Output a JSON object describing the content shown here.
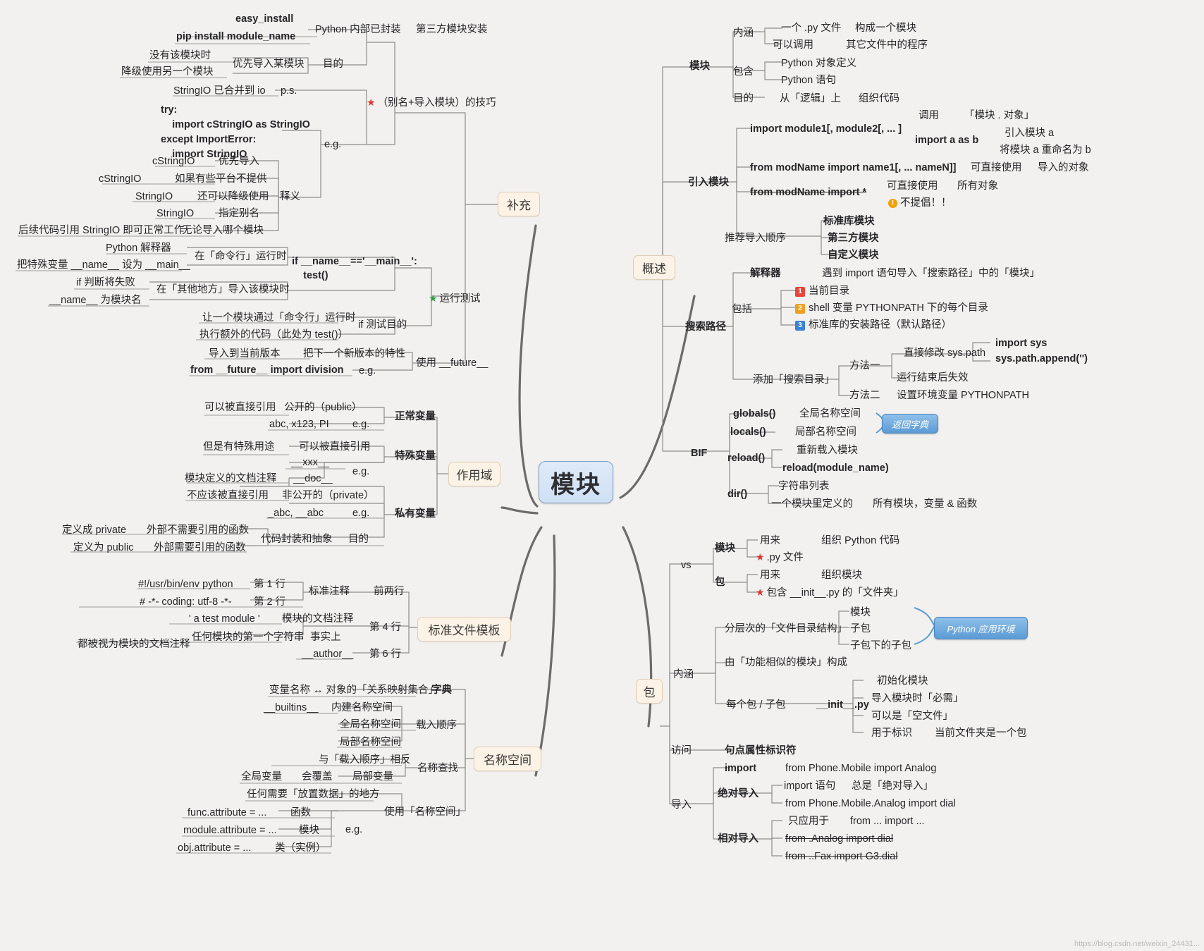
{
  "title": "模块",
  "root": {
    "label": "模块"
  },
  "level1": [
    {
      "label": "补充"
    },
    {
      "label": "概述"
    },
    {
      "label": "作用域"
    },
    {
      "label": "标准文件模板"
    },
    {
      "label": "名称空间"
    },
    {
      "label": "包"
    }
  ],
  "bubbles": [
    {
      "label": "返回字典"
    },
    {
      "label": "Python 应用环境"
    }
  ],
  "supplement": {
    "install": {
      "easy_install": "easy_install",
      "pip": "pip install module_name",
      "python_builtin": "Python 内部已封装",
      "third_party": "第三方模块安装"
    },
    "alias_trick": {
      "label": "（别名+导入模块）的技巧",
      "purpose_label": "目的",
      "purpose_a": "优先导入某模块",
      "purpose_b": "没有该模块时",
      "purpose_c": "降级使用另一个模块",
      "ps_label": "p.s.",
      "ps_text": "StringIO 已合并到 io",
      "eg_label": "e.g.",
      "code": "try:\n    import cStringIO as StringIO\nexcept ImportError:\n    import StringIO",
      "explain_label": "释义",
      "rows": [
        {
          "left": "cStringIO",
          "right": "优先导入"
        },
        {
          "left": "cStringIO",
          "right": "如果有些平台不提供"
        },
        {
          "left": "StringIO",
          "right": "还可以降级使用"
        },
        {
          "left": "StringIO",
          "right": "指定别名"
        },
        {
          "left": "后续代码引用 StringIO 即可正常工作",
          "right": "无论导入哪个模块"
        }
      ]
    },
    "run_test": {
      "label": "运行测试",
      "code": "if __name__=='__main__':\n    test()",
      "cmdline": "在「命令行」运行时",
      "cmdline_a": "Python 解释器",
      "cmdline_b": "把特殊变量 __name__ 设为 __main__",
      "elsewhere": "在「其他地方」导入该模块时",
      "elsewhere_a": "if 判断将失败",
      "elsewhere_b": "__name__ 为模块名",
      "purpose_label": "if 测试目的",
      "purpose_a": "让一个模块通过「命令行」运行时",
      "purpose_b": "执行额外的代码（此处为 test()）"
    },
    "future": {
      "label": "使用 __future__",
      "a": "把下一个新版本的特性",
      "b": "导入到当前版本",
      "eg_label": "e.g.",
      "code": "from __future__ import division"
    }
  },
  "overview": {
    "module": {
      "label": "模块",
      "connotation_label": "内涵",
      "connotation": [
        {
          "left": "一个 .py 文件",
          "right": "构成一个模块"
        },
        {
          "left": "可以调用",
          "right": "其它文件中的程序"
        }
      ],
      "contains_label": "包含",
      "contains": [
        "Python 对象定义",
        "Python 语句"
      ],
      "purpose_label": "目的",
      "purpose_a": "从「逻辑」上",
      "purpose_b": "组织代码"
    },
    "import": {
      "label": "引入模块",
      "stmt1": "import module1[, module2[, ... ]",
      "stmt1_a": "调用",
      "stmt1_b": "「模块 . 对象」",
      "stmt_as": "import a as b",
      "stmt_as_a": "引入模块 a",
      "stmt_as_b": "将模块 a 重命名为 b",
      "stmt2": "from modName import name1[, ... nameN]]",
      "stmt2_a": "可直接使用",
      "stmt2_b": "导入的对象",
      "stmt3": "from modName import *",
      "stmt3_a": "可直接使用",
      "stmt3_b": "所有对象",
      "stmt3_warn": "不提倡！！",
      "order_label": "推荐导入顺序",
      "order": [
        "标准库模块",
        "第三方模块",
        "自定义模块"
      ]
    },
    "search_path": {
      "label": "搜索路径",
      "interpreter": "解释器",
      "interpreter_a": "遇到 import 语句",
      "interpreter_b": "导入「搜索路径」中的「模块」",
      "includes_label": "包括",
      "includes": [
        {
          "n": "1",
          "text": "当前目录"
        },
        {
          "n": "2",
          "text": "shell 变量 PYTHONPATH 下的每个目录"
        },
        {
          "n": "3",
          "text": "标准库的安装路径（默认路径）"
        }
      ],
      "add_label": "添加「搜索目录」",
      "m1_label": "方法一",
      "m1_a": "直接修改 sys.path",
      "m1_code": "import sys\nsys.path.append('')",
      "m1_b": "运行结束后失效",
      "m2_label": "方法二",
      "m2_a": "设置环境变量 PYTHONPATH"
    },
    "bif": {
      "label": "BIF",
      "globals": "globals()",
      "globals_desc": "全局名称空间",
      "locals": "locals()",
      "locals_desc": "局部名称空间",
      "reload": "reload()",
      "reload_desc": "重新载入模块",
      "reload_code": "reload(module_name)",
      "dir": "dir()",
      "dir_desc": "字符串列表",
      "dir_a": "一个模块里定义的",
      "dir_b": "所有模块，变量 & 函数"
    }
  },
  "scope": {
    "normal": {
      "label": "正常变量",
      "a": "可以被直接引用",
      "b": "公开的（public）",
      "eg_label": "e.g.",
      "eg": "abc, x123, PI"
    },
    "special": {
      "label": "特殊变量",
      "a": "但是有特殊用途",
      "b": "可以被直接引用",
      "eg_label": "e.g.",
      "eg1": "__xxx__",
      "eg2": "__doc__",
      "eg2_desc": "模块定义的文档注释"
    },
    "private": {
      "label": "私有变量",
      "a": "不应该被直接引用",
      "b": "非公开的（private）",
      "eg_label": "e.g.",
      "eg": "_abc, __abc",
      "purpose_label": "目的",
      "purpose": "代码封装和抽象",
      "rule_a": "定义成 private",
      "rule_a_desc": "外部不需要引用的函数",
      "rule_b": "定义为 public",
      "rule_b_desc": "外部需要引用的函数"
    }
  },
  "template": {
    "std_comment_label": "标准注释",
    "std_comment_desc": "前两行",
    "line1": "#!/usr/bin/env python",
    "line1_no": "第 1 行",
    "line2": "# -*- coding: utf-8 -*-",
    "line2_no": "第 2 行",
    "doc_label": "模块的文档注释",
    "doc_value": "' a test module '",
    "doc_no": "第 4 行",
    "doc_fact_label": "事实上",
    "doc_fact_a": "任何模块的第一个字符串",
    "doc_fact_b": "都被视为模块的文档注释",
    "author": "__author__",
    "author_no": "第 6 行"
  },
  "namespace": {
    "dict_label": "字典",
    "dict_desc": "变量名称 ↔ 对象的「关系映射集合」",
    "load_order_label": "载入顺序",
    "load_order": [
      {
        "left": "__builtins__",
        "right": "内建名称空间"
      },
      {
        "left": "",
        "right": "全局名称空间"
      },
      {
        "left": "",
        "right": "局部名称空间"
      }
    ],
    "lookup_label": "名称查找",
    "lookup_a": "与「载入顺序」相反",
    "lookup_b1": "全局变量",
    "lookup_b2": "会覆盖",
    "lookup_b3": "局部变量",
    "use_label": "使用「名称空间」",
    "use_a": "任何需要「放置数据」的地方",
    "eg_label": "e.g.",
    "eg": [
      {
        "left": "func.attribute = ...",
        "right": "函数"
      },
      {
        "left": "module.attribute = ...",
        "right": "模块"
      },
      {
        "left": "obj.attribute = ...",
        "right": "类（实例）"
      }
    ]
  },
  "package": {
    "vs_label": "vs",
    "module_label": "模块",
    "module_use": "用来",
    "module_use_desc": "组织 Python 代码",
    "module_file": ".py 文件",
    "pkg_label": "包",
    "pkg_use": "用来",
    "pkg_use_desc": "组织模块",
    "pkg_file": "包含 __init__.py 的「文件夹」",
    "connotation_label": "内涵",
    "structure_label": "分层次的「文件目录结构」",
    "structure": [
      "模块",
      "子包",
      "子包下的子包"
    ],
    "composed": "由「功能相似的模块」构成",
    "each_pkg": "每个包 / 子包",
    "init_py": "__init__.py",
    "init_notes": [
      "初始化模块",
      "导入模块时「必需」",
      "可以是「空文件」",
      "用于标识"
    ],
    "init_last_desc": "当前文件夹是一个包",
    "access_label": "访问",
    "access_desc": "句点属性标识符",
    "import_label": "import",
    "import_eg": "from Phone.Mobile import Analog",
    "import_section_label": "导入",
    "absolute_label": "绝对导入",
    "absolute_a": "import 语句",
    "absolute_b": "总是「绝对导入」",
    "absolute_c": "from Phone.Mobile.Analog import dial",
    "relative_label": "相对导入",
    "relative_a": "只应用于",
    "relative_b": "from ... import ...",
    "relative_c": "from .Analog import dial",
    "relative_d": "from ..Fax import G3.dial"
  },
  "watermark": "https://blog.csdn.net/weixin_24431..."
}
